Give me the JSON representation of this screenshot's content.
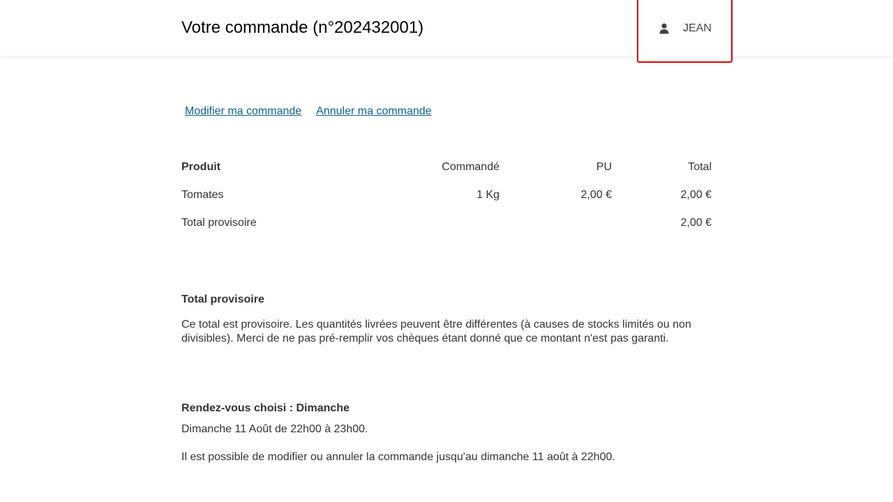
{
  "header": {
    "title": "Votre commande (n°202432001)",
    "user": {
      "icon": "user-icon",
      "name": "JEAN",
      "highlight_color": "#e00000"
    }
  },
  "actions": {
    "modify_label": "Modifier ma commande",
    "cancel_label": "Annuler ma commande",
    "link_color": "#0b5f8a"
  },
  "order_table": {
    "headers": {
      "product": "Produit",
      "ordered": "Commandé",
      "unit_price": "PU",
      "total": "Total"
    },
    "rows": [
      {
        "product": "Tomates",
        "ordered": "1 Kg",
        "unit_price": "2,00 €",
        "total": "2,00 €"
      }
    ],
    "subtotal": {
      "label": "Total provisoire",
      "total": "2,00 €"
    }
  },
  "provisional_notice": {
    "heading": "Total provisoire",
    "text": "Ce total est provisoire. Les quantités livrées peuvent être différentes (à causes de stocks limités ou non divisibles). Merci de ne pas pré-remplir vos chèques étant donné que ce montant n'est pas garanti."
  },
  "appointment": {
    "heading": "Rendez-vous choisi : Dimanche",
    "slot": "Dimanche 11 Août de 22h00 à 23h00.",
    "deadline": "Il est possible de modifier ou annuler la commande jusqu'au dimanche 11 août à 22h00."
  }
}
